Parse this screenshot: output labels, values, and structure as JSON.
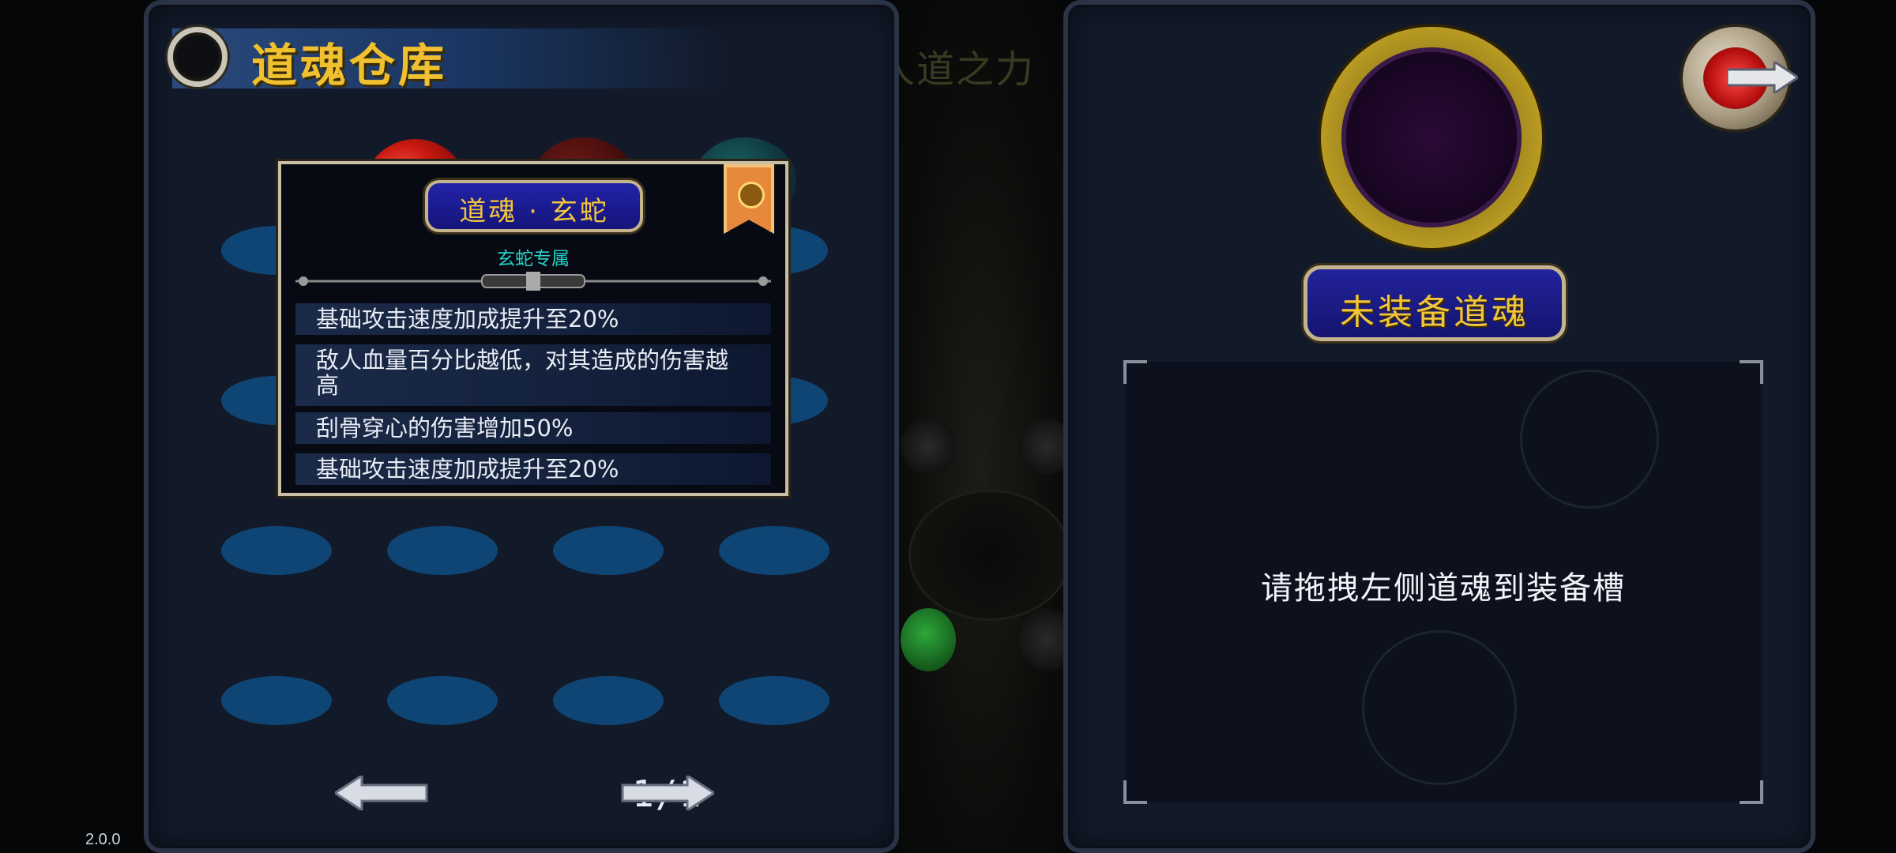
{
  "warehouse": {
    "title": "道魂仓库",
    "page_indicator": "1/1"
  },
  "background": {
    "ghost_title": "人道之力"
  },
  "tooltip": {
    "name": "道魂 · 玄蛇",
    "subtitle": "玄蛇专属",
    "effects": [
      "基础攻击速度加成提升至20%",
      "敌人血量百分比越低，对其造成的伤害越高",
      "刮骨穿心的伤害增加50%",
      "基础攻击速度加成提升至20%"
    ]
  },
  "equip": {
    "status": "未装备道魂",
    "hint": "请拖拽左侧道魂到装备槽"
  },
  "footer": {
    "version": "2.0.0"
  },
  "colors": {
    "title_gold": "#f0c030",
    "panel_bg": "#121a2a",
    "slot_blue": "#0f4574",
    "subtitle_teal": "#26d3c8",
    "plate_blue": "#23239c"
  }
}
